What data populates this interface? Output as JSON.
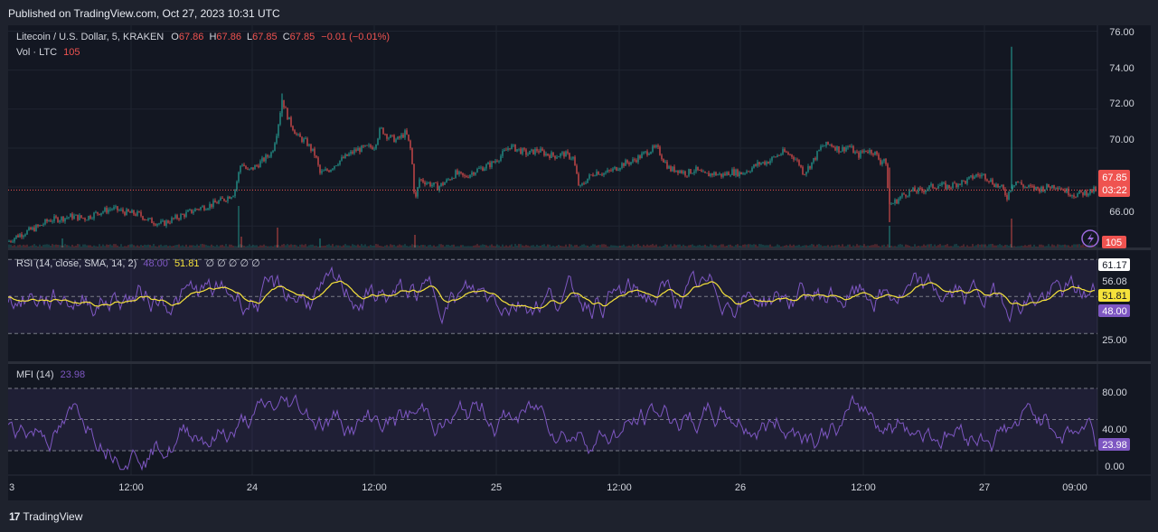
{
  "header": {
    "published": "Published on TradingView.com, Oct 27, 2023 10:31 UTC"
  },
  "main_legend": {
    "symbol": "Litecoin / U.S. Dollar, 5, KRAKEN",
    "o_label": "O",
    "o_value": "67.86",
    "h_label": "H",
    "h_value": "67.86",
    "l_label": "L",
    "l_value": "67.85",
    "c_label": "C",
    "c_value": "67.85",
    "change": "−0.01 (−0.01%)",
    "vol_label": "Vol · LTC",
    "vol_value": "105"
  },
  "rsi_legend": {
    "label": "RSI (14, close, SMA, 14, 2)",
    "value": "48.00",
    "sma": "51.81",
    "placeholders": "∅ ∅ ∅ ∅ ∅"
  },
  "mfi_legend": {
    "label": "MFI (14)",
    "value": "23.98"
  },
  "price_axis": {
    "ticks": [
      "76.00",
      "74.00",
      "72.00",
      "70.00",
      "66.00"
    ],
    "last_price": "67.85",
    "countdown": "03:22",
    "volume_tag": "105"
  },
  "rsi_axis": {
    "ticks": [
      "61.17",
      "56.08",
      "25.00"
    ],
    "sma_tag": "51.81",
    "rsi_tag": "48.00"
  },
  "mfi_axis": {
    "ticks": [
      "80.00",
      "40.00",
      "0.00"
    ],
    "mfi_tag": "23.98"
  },
  "time_axis": {
    "ticks": [
      "3",
      "12:00",
      "24",
      "12:00",
      "25",
      "12:00",
      "26",
      "12:00",
      "27",
      "09:00"
    ]
  },
  "footer": {
    "brand": "TradingView",
    "logo_mark": "17"
  },
  "colors": {
    "up": "#26a69a",
    "down": "#ef5350",
    "rsi": "#7e57c2",
    "sma": "#f5e23b",
    "mfi": "#7e57c2",
    "bg": "#131722",
    "frame": "#1e222d"
  },
  "chart_data": {
    "type": "candlestick",
    "ylim": [
      64.9,
      76.3
    ],
    "close_path": [
      [
        0,
        65.2
      ],
      [
        10,
        65.5
      ],
      [
        20,
        65.7
      ],
      [
        35,
        66.0
      ],
      [
        45,
        66.3
      ],
      [
        60,
        66.4
      ],
      [
        70,
        66.5
      ],
      [
        85,
        66.4
      ],
      [
        100,
        66.7
      ],
      [
        115,
        66.9
      ],
      [
        130,
        66.7
      ],
      [
        145,
        66.6
      ],
      [
        155,
        66.3
      ],
      [
        170,
        66.1
      ],
      [
        185,
        66.4
      ],
      [
        195,
        66.6
      ],
      [
        210,
        66.9
      ],
      [
        225,
        67.1
      ],
      [
        240,
        67.4
      ],
      [
        250,
        67.7
      ],
      [
        258,
        69.3
      ],
      [
        265,
        68.8
      ],
      [
        275,
        69.1
      ],
      [
        285,
        69.5
      ],
      [
        292,
        69.8
      ],
      [
        298,
        71.0
      ],
      [
        303,
        72.5
      ],
      [
        310,
        71.5
      ],
      [
        320,
        70.6
      ],
      [
        330,
        70.3
      ],
      [
        340,
        69.6
      ],
      [
        345,
        68.7
      ],
      [
        355,
        68.9
      ],
      [
        365,
        69.3
      ],
      [
        375,
        69.6
      ],
      [
        385,
        69.9
      ],
      [
        395,
        70.0
      ],
      [
        405,
        70.1
      ],
      [
        412,
        71.0
      ],
      [
        420,
        70.6
      ],
      [
        430,
        70.4
      ],
      [
        440,
        70.8
      ],
      [
        446,
        69.8
      ],
      [
        450,
        67.2
      ],
      [
        455,
        68.4
      ],
      [
        465,
        68.2
      ],
      [
        475,
        68.0
      ],
      [
        485,
        68.3
      ],
      [
        495,
        68.7
      ],
      [
        505,
        68.5
      ],
      [
        515,
        68.8
      ],
      [
        525,
        69.0
      ],
      [
        535,
        69.2
      ],
      [
        545,
        69.6
      ],
      [
        555,
        70.1
      ],
      [
        565,
        69.9
      ],
      [
        575,
        69.7
      ],
      [
        585,
        69.9
      ],
      [
        595,
        69.7
      ],
      [
        605,
        69.6
      ],
      [
        615,
        69.7
      ],
      [
        625,
        69.5
      ],
      [
        632,
        67.9
      ],
      [
        640,
        68.4
      ],
      [
        650,
        68.8
      ],
      [
        660,
        68.7
      ],
      [
        670,
        68.9
      ],
      [
        680,
        69.2
      ],
      [
        690,
        69.3
      ],
      [
        700,
        69.6
      ],
      [
        710,
        69.9
      ],
      [
        718,
        70.0
      ],
      [
        725,
        69.4
      ],
      [
        732,
        68.9
      ],
      [
        740,
        68.9
      ],
      [
        750,
        68.7
      ],
      [
        760,
        68.9
      ],
      [
        770,
        68.6
      ],
      [
        780,
        68.7
      ],
      [
        790,
        68.6
      ],
      [
        800,
        68.8
      ],
      [
        810,
        68.7
      ],
      [
        820,
        68.9
      ],
      [
        830,
        69.2
      ],
      [
        840,
        69.3
      ],
      [
        850,
        69.6
      ],
      [
        858,
        69.8
      ],
      [
        868,
        69.6
      ],
      [
        875,
        69.2
      ],
      [
        880,
        68.7
      ],
      [
        890,
        69.3
      ],
      [
        900,
        70.1
      ],
      [
        910,
        70.2
      ],
      [
        920,
        69.9
      ],
      [
        930,
        70.1
      ],
      [
        940,
        69.6
      ],
      [
        948,
        69.9
      ],
      [
        958,
        69.8
      ],
      [
        965,
        69.3
      ],
      [
        970,
        69.5
      ],
      [
        975,
        67.1
      ],
      [
        980,
        67.2
      ],
      [
        990,
        67.6
      ],
      [
        1000,
        67.8
      ],
      [
        1010,
        67.8
      ],
      [
        1020,
        68.0
      ],
      [
        1030,
        68.1
      ],
      [
        1040,
        68.0
      ],
      [
        1050,
        68.2
      ],
      [
        1060,
        68.3
      ],
      [
        1070,
        68.6
      ],
      [
        1080,
        68.6
      ],
      [
        1090,
        68.2
      ],
      [
        1100,
        67.9
      ],
      [
        1105,
        67.5
      ],
      [
        1110,
        68.1
      ],
      [
        1115,
        68.3
      ],
      [
        1125,
        68.0
      ],
      [
        1140,
        67.9
      ],
      [
        1150,
        68.0
      ],
      [
        1160,
        68.1
      ],
      [
        1170,
        67.8
      ],
      [
        1180,
        67.6
      ],
      [
        1190,
        67.7
      ],
      [
        1203,
        67.85
      ]
    ]
  }
}
